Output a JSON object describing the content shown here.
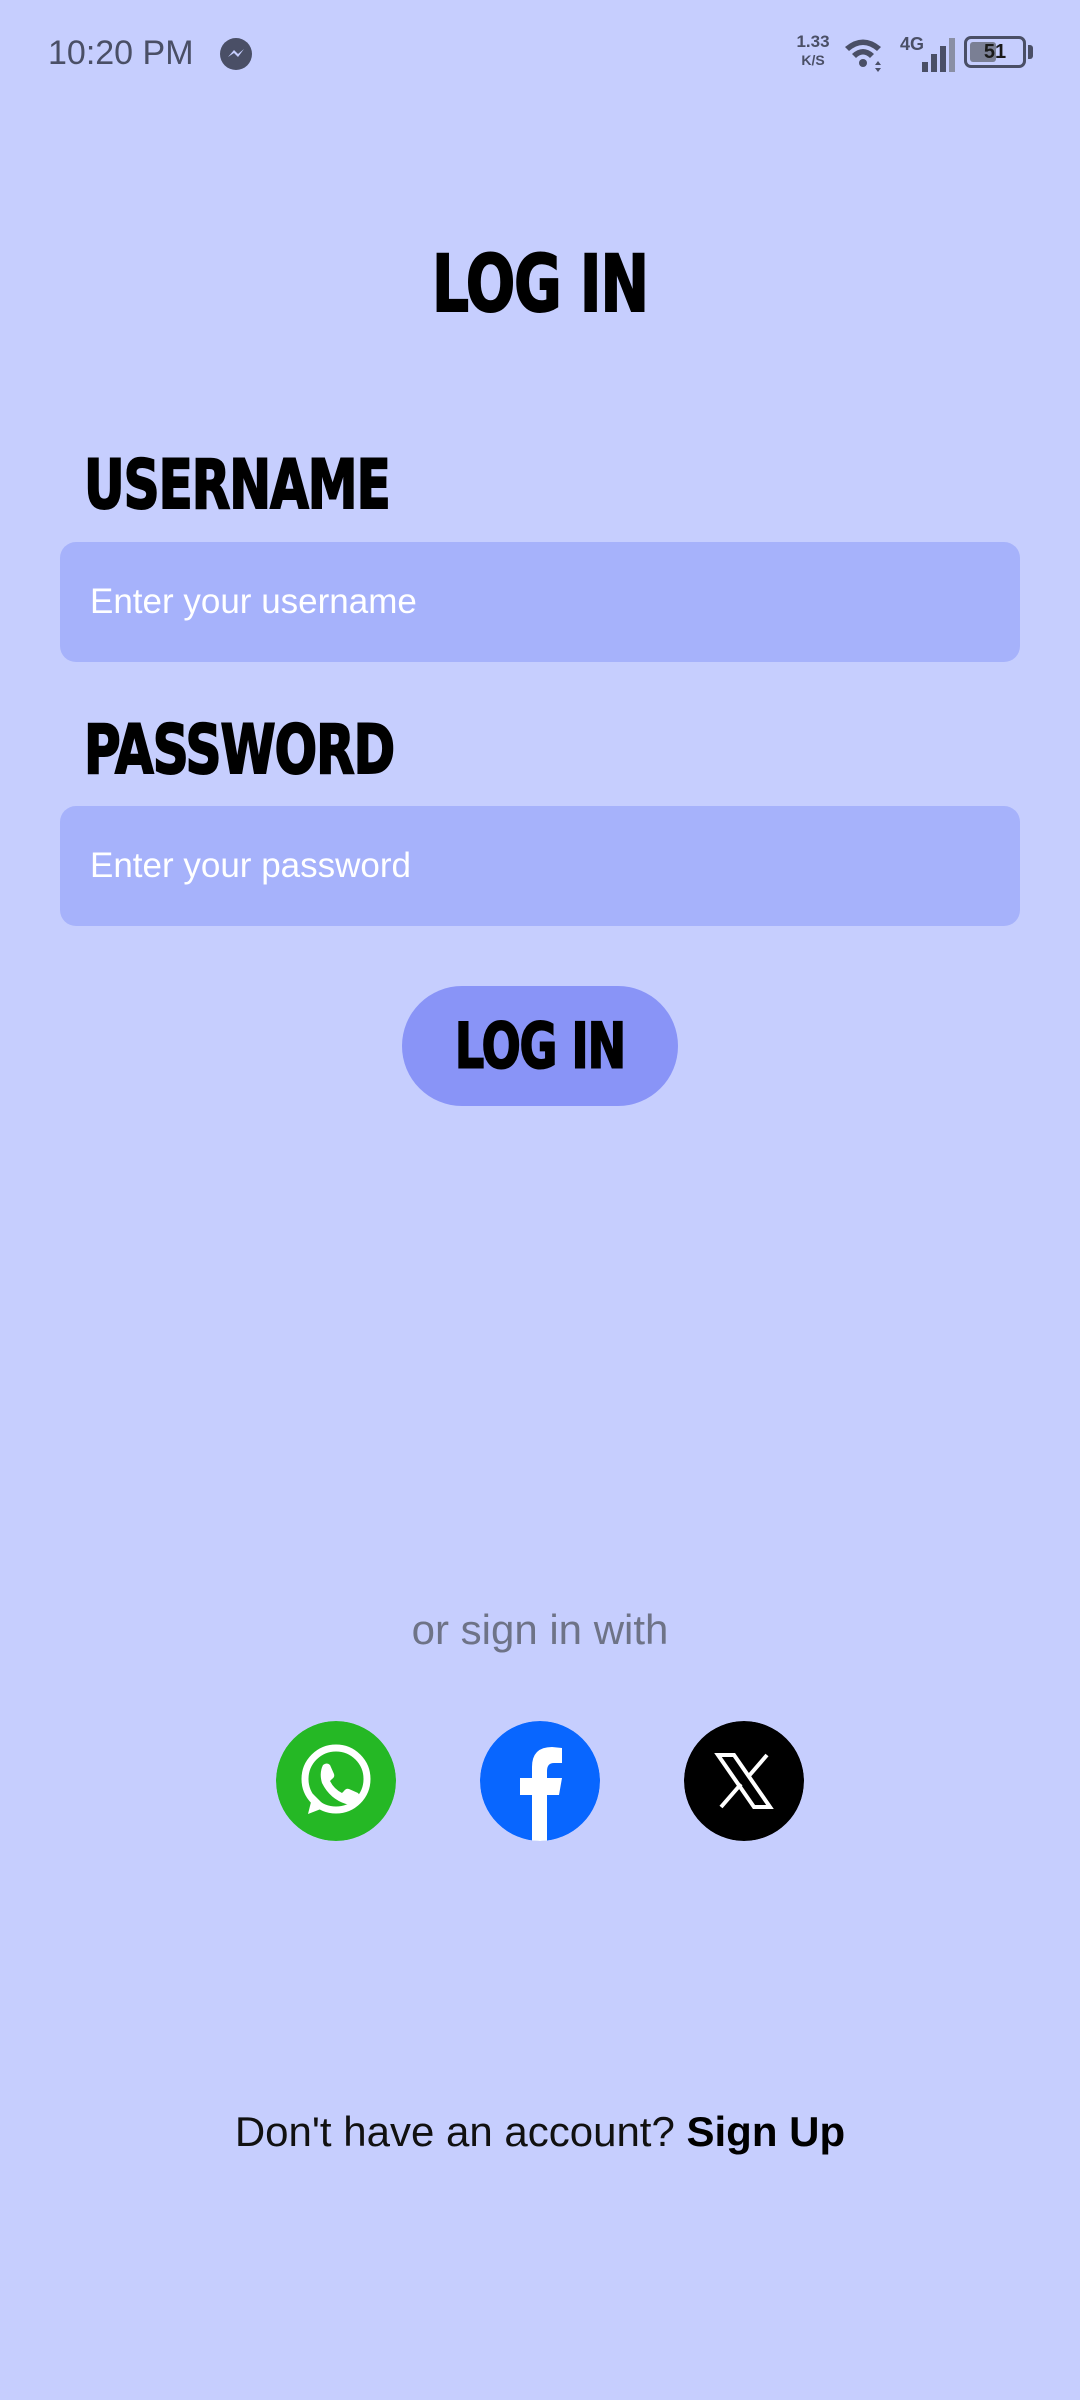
{
  "status_bar": {
    "time": "10:20 PM",
    "network_speed_value": "1.33",
    "network_speed_unit": "K/S",
    "network_type": "4G",
    "battery_level": "51",
    "battery_fraction": 0.51,
    "icons": [
      "messenger-icon",
      "wifi-icon",
      "signal-icon",
      "battery-icon"
    ]
  },
  "page": {
    "title": "LOG IN"
  },
  "form": {
    "username_label": "USERNAME",
    "username_placeholder": "Enter your username",
    "username_value": "",
    "password_label": "PASSWORD",
    "password_placeholder": "Enter your password",
    "password_value": "",
    "submit_label": "LOG IN"
  },
  "social": {
    "prompt": "or sign in with",
    "providers": [
      {
        "name": "WhatsApp",
        "icon": "whatsapp-icon",
        "color": "#25b825"
      },
      {
        "name": "Facebook",
        "icon": "facebook-icon",
        "color": "#0866ff"
      },
      {
        "name": "X",
        "icon": "x-icon",
        "color": "#000000"
      }
    ]
  },
  "footer": {
    "prompt": "Don't have an account?",
    "link_label": "Sign Up"
  },
  "colors": {
    "background": "#c6cefe",
    "input_fill": "#a6b2fb",
    "button_fill": "#8994f7"
  }
}
